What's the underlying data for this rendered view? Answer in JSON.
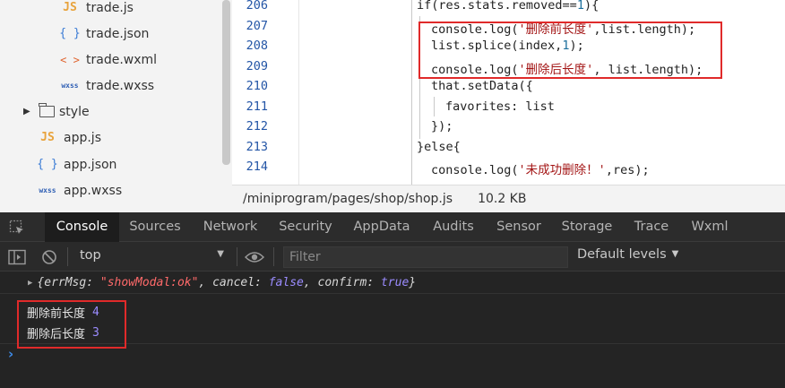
{
  "file_tree": {
    "items": [
      {
        "icon": "JS",
        "label": "trade.js"
      },
      {
        "icon": "{ }",
        "label": "trade.json"
      },
      {
        "icon": "< >",
        "label": "trade.wxml"
      },
      {
        "icon": "wxss",
        "label": "trade.wxss"
      },
      {
        "icon": "folder",
        "label": "style"
      },
      {
        "icon": "JS",
        "label": "app.js"
      },
      {
        "icon": "{ }",
        "label": "app.json"
      },
      {
        "icon": "wxss",
        "label": "app.wxss"
      }
    ]
  },
  "editor": {
    "line_numbers": [
      "206",
      "207",
      "208",
      "209",
      "210",
      "211",
      "212",
      "213",
      "214"
    ],
    "lines": {
      "l206_pre": "if(res.stats.removed==",
      "l206_num": "1",
      "l206_post": "){",
      "l207_pre": "console.log(",
      "l207_str": "'删除前长度'",
      "l207_post": ",list.length);",
      "l208_pre": "list.splice(index,",
      "l208_num": "1",
      "l208_post": ");",
      "l209_pre": "console.log(",
      "l209_str": "'删除后长度'",
      "l209_post": ", list.length);",
      "l210": "that.setData({",
      "l211": "favorites: list",
      "l212": "});",
      "l213": "}else{",
      "l214_pre": "console.log(",
      "l214_str": "'未成功删除！'",
      "l214_post": ",res);"
    }
  },
  "status_bar": {
    "path": "/miniprogram/pages/shop/shop.js",
    "size": "10.2 KB"
  },
  "devtools": {
    "tabs": [
      "Console",
      "Sources",
      "Network",
      "Security",
      "AppData",
      "Audits",
      "Sensor",
      "Storage",
      "Trace",
      "Wxml"
    ],
    "active_tab": "Console",
    "context": "top",
    "filter_placeholder": "Filter",
    "levels": "Default levels"
  },
  "console": {
    "object_line": {
      "open": "{",
      "k1": "errMsg: ",
      "v1": "\"showModal:ok\"",
      "k2": ", cancel: ",
      "v2": "false",
      "k3": ", confirm: ",
      "v3": "true",
      "close": "}"
    },
    "logs": [
      {
        "text": "删除前长度",
        "value": "4"
      },
      {
        "text": "删除后长度",
        "value": "3"
      }
    ]
  },
  "colors": {
    "highlight_box": "#e02a2a",
    "console_number": "#9b8cff",
    "console_string": "#ff6a6a"
  }
}
